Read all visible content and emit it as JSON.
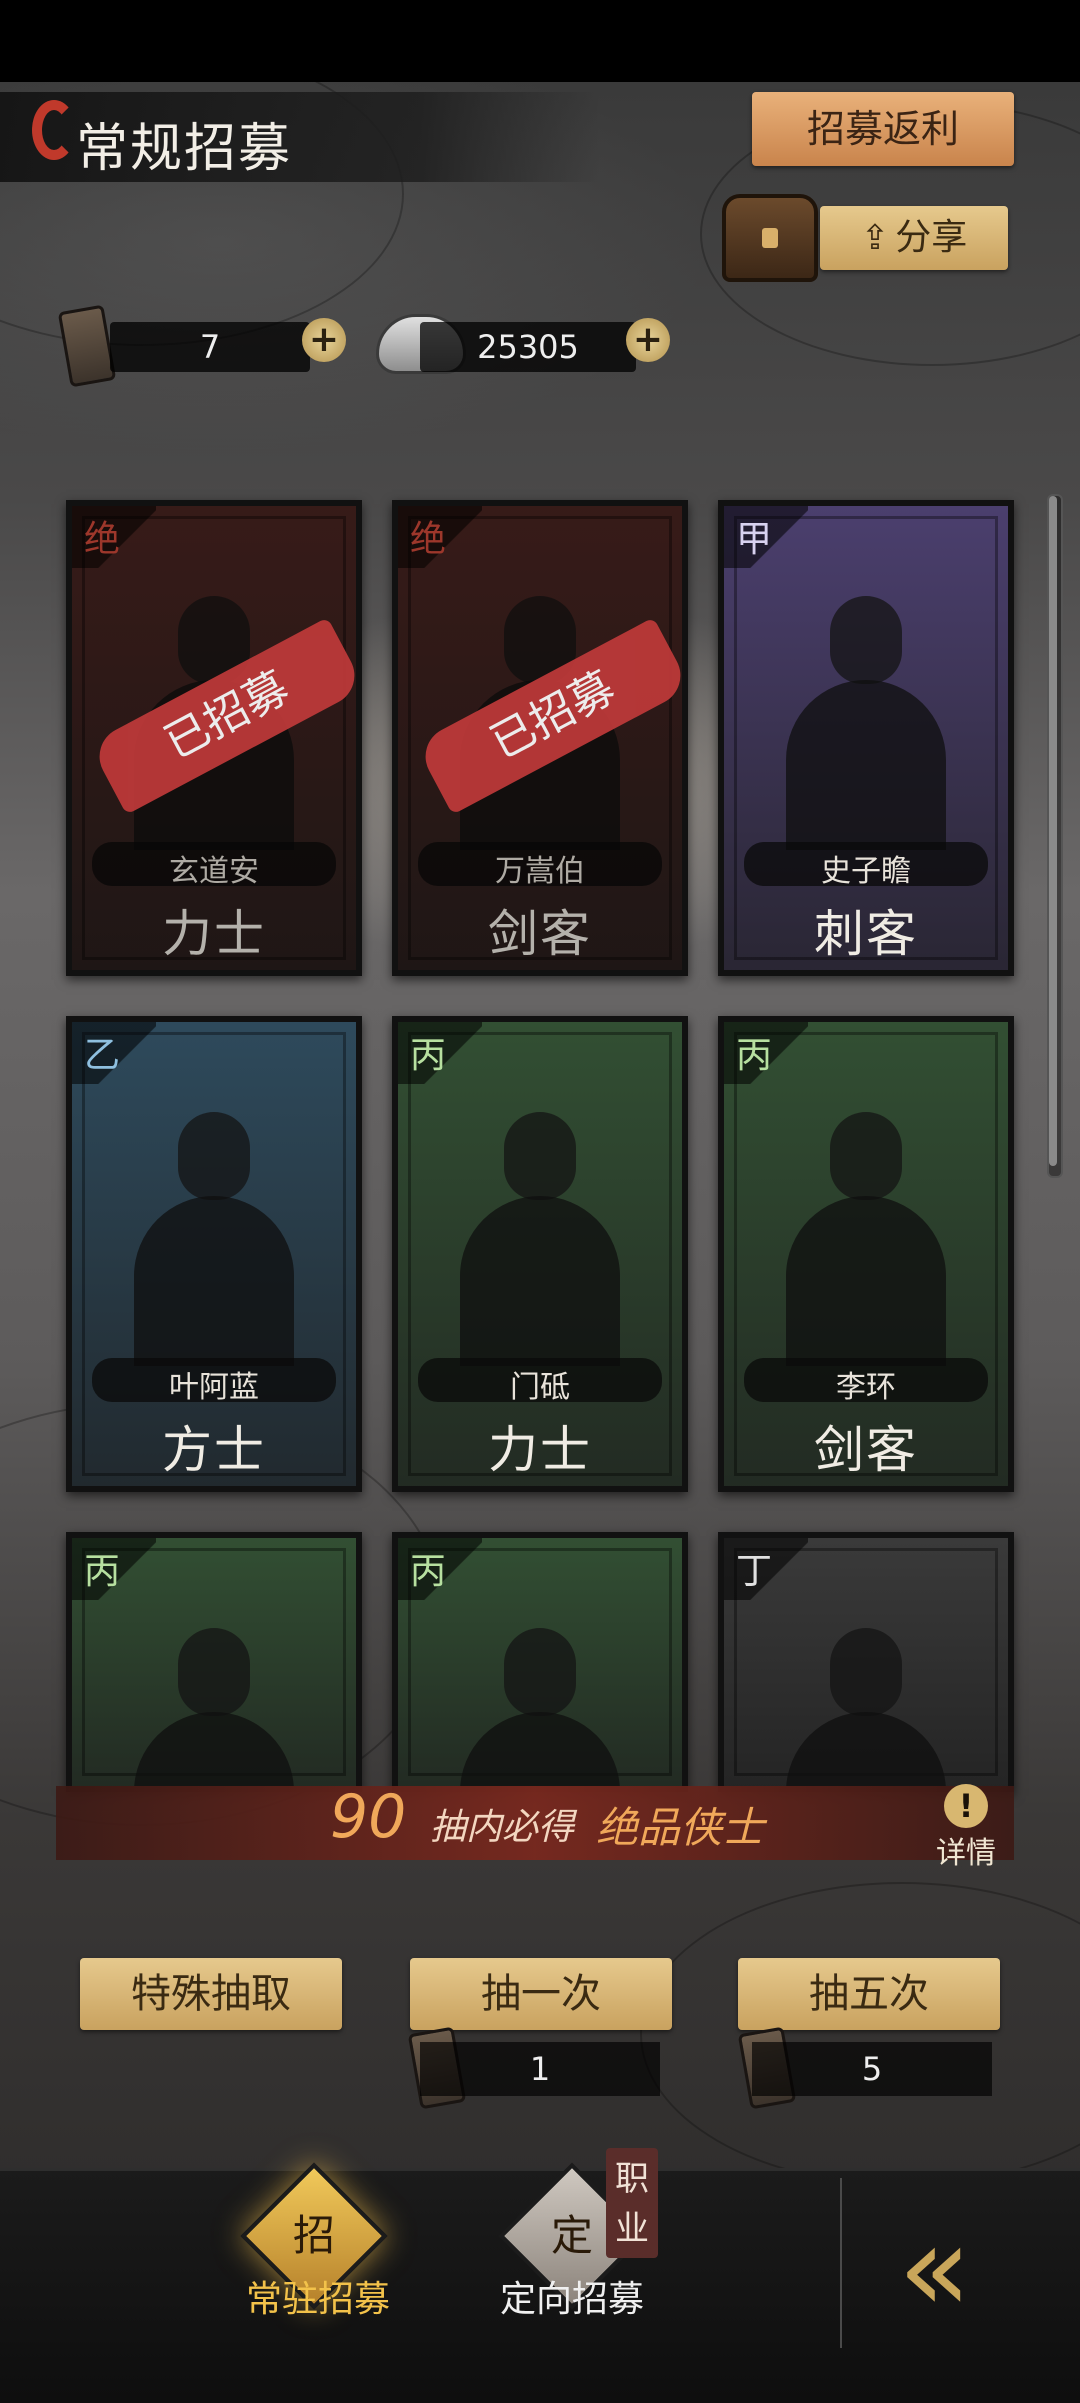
{
  "header": {
    "title": "常规招募",
    "rebate_button": "招募返利",
    "share_button": "分享"
  },
  "resources": {
    "ticket_count": "7",
    "silver_count": "25305"
  },
  "cards": [
    {
      "rank": "绝",
      "name": "玄道安",
      "class": "力士",
      "recruited": true,
      "recruited_label": "已招募",
      "theme": "#4a2420",
      "rank_color": "#d24a3a"
    },
    {
      "rank": "绝",
      "name": "万嵩伯",
      "class": "剑客",
      "recruited": true,
      "recruited_label": "已招募",
      "theme": "#4a2420",
      "rank_color": "#d24a3a"
    },
    {
      "rank": "甲",
      "name": "史子瞻",
      "class": "刺客",
      "recruited": false,
      "theme": "#4b3f6e",
      "rank_color": "#d8d2f0"
    },
    {
      "rank": "乙",
      "name": "叶阿蓝",
      "class": "方士",
      "recruited": false,
      "theme": "#2e4a5c",
      "rank_color": "#8fc0e0"
    },
    {
      "rank": "丙",
      "name": "门砥",
      "class": "力士",
      "recruited": false,
      "theme": "#324f33",
      "rank_color": "#b7e0a0"
    },
    {
      "rank": "丙",
      "name": "李环",
      "class": "剑客",
      "recruited": false,
      "theme": "#324f33",
      "rank_color": "#b7e0a0"
    },
    {
      "rank": "丙",
      "name": "",
      "class": "",
      "recruited": false,
      "theme": "#324f33",
      "rank_color": "#b7e0a0"
    },
    {
      "rank": "丙",
      "name": "",
      "class": "",
      "recruited": false,
      "theme": "#324f33",
      "rank_color": "#b7e0a0"
    },
    {
      "rank": "丁",
      "name": "",
      "class": "",
      "recruited": false,
      "theme": "#3a3a3a",
      "rank_color": "#e0e0e0"
    }
  ],
  "guarantee": {
    "number": "90",
    "text": "抽内必得",
    "highlight": "绝品侠士",
    "detail_label": "详情"
  },
  "draw": {
    "special": "特殊抽取",
    "once": "抽一次",
    "five": "抽五次",
    "once_cost": "1",
    "five_cost": "5"
  },
  "nav": {
    "tab1": "常驻招募",
    "tab2": "定向招募",
    "tab1_icon_glyph": "招",
    "tab2_icon_glyph": "定",
    "job_tag": "职业",
    "back_glyph": "«"
  },
  "colors": {
    "accent_gold": "#e6c98d",
    "recruited_red": "#c03a3a",
    "active_tab": "#f3c24a"
  }
}
